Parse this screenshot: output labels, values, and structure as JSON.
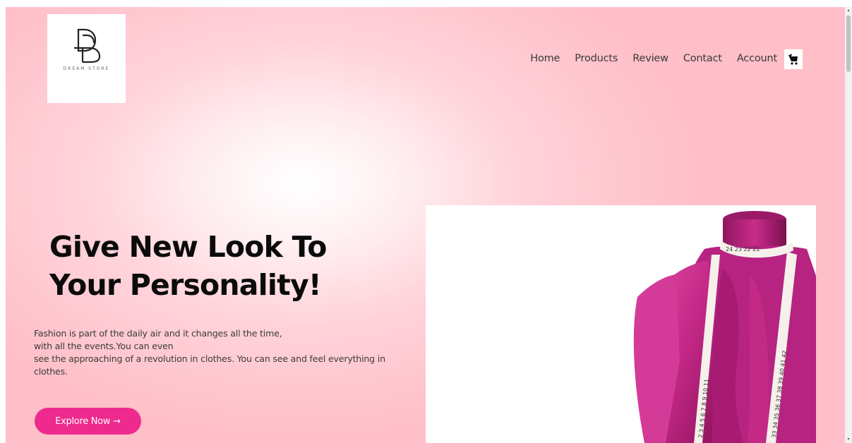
{
  "logo": {
    "text": "DREAM STORE"
  },
  "nav": {
    "items": [
      {
        "label": "Home"
      },
      {
        "label": "Products"
      },
      {
        "label": "Review"
      },
      {
        "label": "Contact"
      },
      {
        "label": "Account"
      }
    ]
  },
  "hero": {
    "title_line1": "Give New Look To",
    "title_line2": "Your Personality!",
    "desc_line1": "Fashion is part of the daily air and it changes all the time,",
    "desc_line2": "with all the events.You can even",
    "desc_line3": "see the approaching of a revolution in clothes. You can see and feel everything in",
    "desc_line4": "clothes.",
    "button_label": "Explore Now",
    "button_arrow": "→"
  },
  "tape": {
    "neck_numbers": "24 23 22 21",
    "left_numbers": "2 3 4 5 6 7 8 9 10 11",
    "right_numbers": "33 34 35 36 37 38 39 40 41 42"
  },
  "colors": {
    "accent": "#ee2a8e",
    "background": "#ffc6ce",
    "fabric": "#d12b8a"
  }
}
